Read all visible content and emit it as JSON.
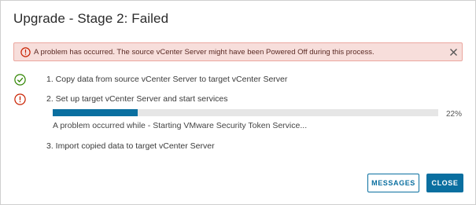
{
  "dialog": {
    "title": "Upgrade - Stage 2: Failed"
  },
  "alert": {
    "icon": "error-circle-icon",
    "message": "A problem has occurred. The source vCenter Server might have been Powered Off during this process.",
    "close_icon": "close-icon"
  },
  "steps": [
    {
      "status": "success",
      "icon": "check-circle-icon",
      "label": "1. Copy data from source vCenter Server to target vCenter Server"
    },
    {
      "status": "error",
      "icon": "error-circle-icon",
      "label": "2. Set up target vCenter Server and start services"
    },
    {
      "status": "pending",
      "icon": "",
      "label": "3. Import copied data to target vCenter Server"
    }
  ],
  "progress": {
    "percent": 22,
    "percent_label": "22%",
    "status": "A problem occurred while - Starting VMware Security Token Service..."
  },
  "buttons": {
    "messages_label": "MESSAGES",
    "close_label": "CLOSE"
  },
  "colors": {
    "accent": "#0a6fa0",
    "error": "#c92100",
    "success": "#2f8400",
    "alert_bg": "#f7dedb"
  }
}
